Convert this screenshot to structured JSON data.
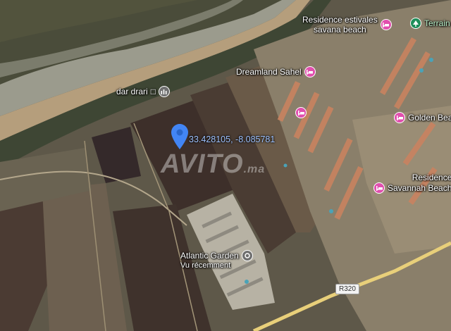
{
  "map": {
    "coordinates": "33.428105, -8.085781",
    "watermark": "AVITO",
    "watermark_suffix": ".ma",
    "road_label": "R320",
    "places": [
      {
        "name": "Residence estivales",
        "name2": "savana beach",
        "icon": "hotel-icon"
      },
      {
        "name": "Terrain",
        "icon": "park-icon"
      },
      {
        "name": "Dreamland Sahel",
        "icon": "hotel-icon"
      },
      {
        "name": "dar drari",
        "icon": "landmark-icon"
      },
      {
        "name": "Golden Bea",
        "icon": "hotel-icon"
      },
      {
        "name": "Residence",
        "name2": "Savannah Beach",
        "icon": "hotel-icon"
      },
      {
        "name": "Atlantic Garden",
        "name2": "Vu récemment",
        "icon": "recent-place-icon"
      }
    ],
    "colors": {
      "pin": "#4285f4",
      "hotel": "#e14fae",
      "park": "#1e8e5a"
    }
  }
}
